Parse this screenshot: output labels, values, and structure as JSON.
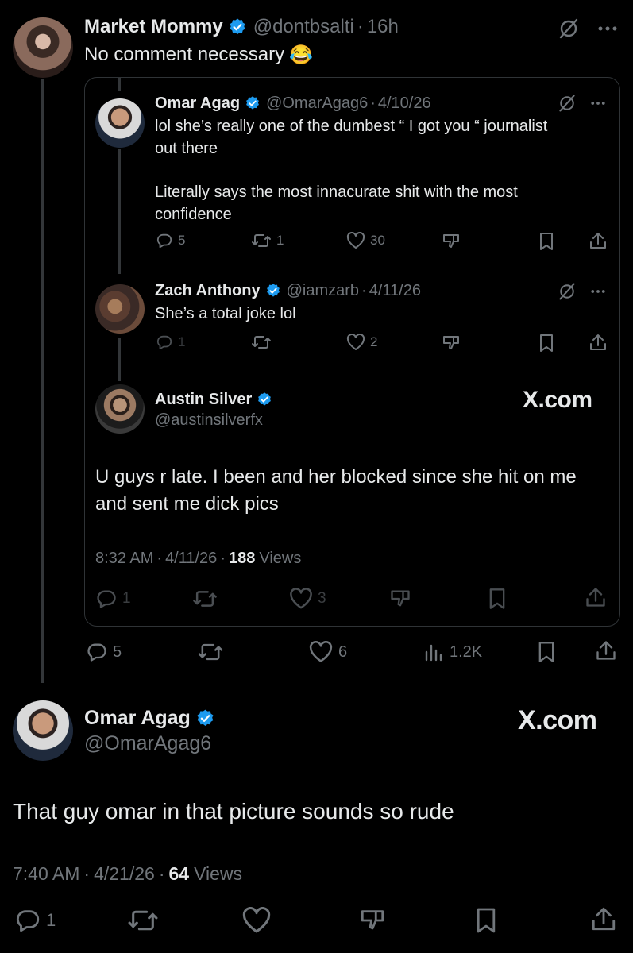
{
  "top_tweet": {
    "name": "Market Mommy",
    "handle": "@dontbsalti",
    "time": "16h",
    "text": "No comment necessary",
    "emoji": "😂",
    "stats": {
      "replies": "5",
      "likes": "6",
      "views": "1.2K"
    }
  },
  "quote": {
    "reply1": {
      "name": "Omar Agag",
      "handle": "@OmarAgag6",
      "date": "4/10/26",
      "line1": "lol she’s really one of the dumbest “ I got you “ journalist",
      "line2": "out there",
      "line3": "Literally says the most innacurate shit with the most",
      "line4": "confidence",
      "stats": {
        "replies": "5",
        "reposts": "1",
        "likes": "30"
      }
    },
    "reply2": {
      "name": "Zach Anthony",
      "handle": "@iamzarb",
      "date": "4/11/26",
      "text": "She’s a total joke lol",
      "stats": {
        "replies": "1",
        "likes": "2"
      }
    },
    "main": {
      "name": "Austin Silver",
      "handle": "@austinsilverfx",
      "brand": "X.com",
      "line1": "U guys r late. I been and her blocked since she hit on me",
      "line2": "and sent me dick pics",
      "time": "8:32 AM",
      "date": "4/11/26",
      "views_count": "188",
      "views_label": "Views",
      "stats": {
        "replies": "1",
        "likes": "3"
      }
    }
  },
  "bottom_tweet": {
    "name": "Omar Agag",
    "handle": "@OmarAgag6",
    "brand": "X.com",
    "text": "That guy omar in that picture sounds so rude",
    "time": "7:40 AM",
    "date": "4/21/26",
    "views_count": "64",
    "views_label": "Views",
    "stats": {
      "replies": "1"
    }
  },
  "separator": "·",
  "colors": {
    "background": "#000000",
    "text": "#e7e9ea",
    "muted": "#71767b",
    "verified": "#1d9bf0",
    "border": "#2f3336"
  }
}
